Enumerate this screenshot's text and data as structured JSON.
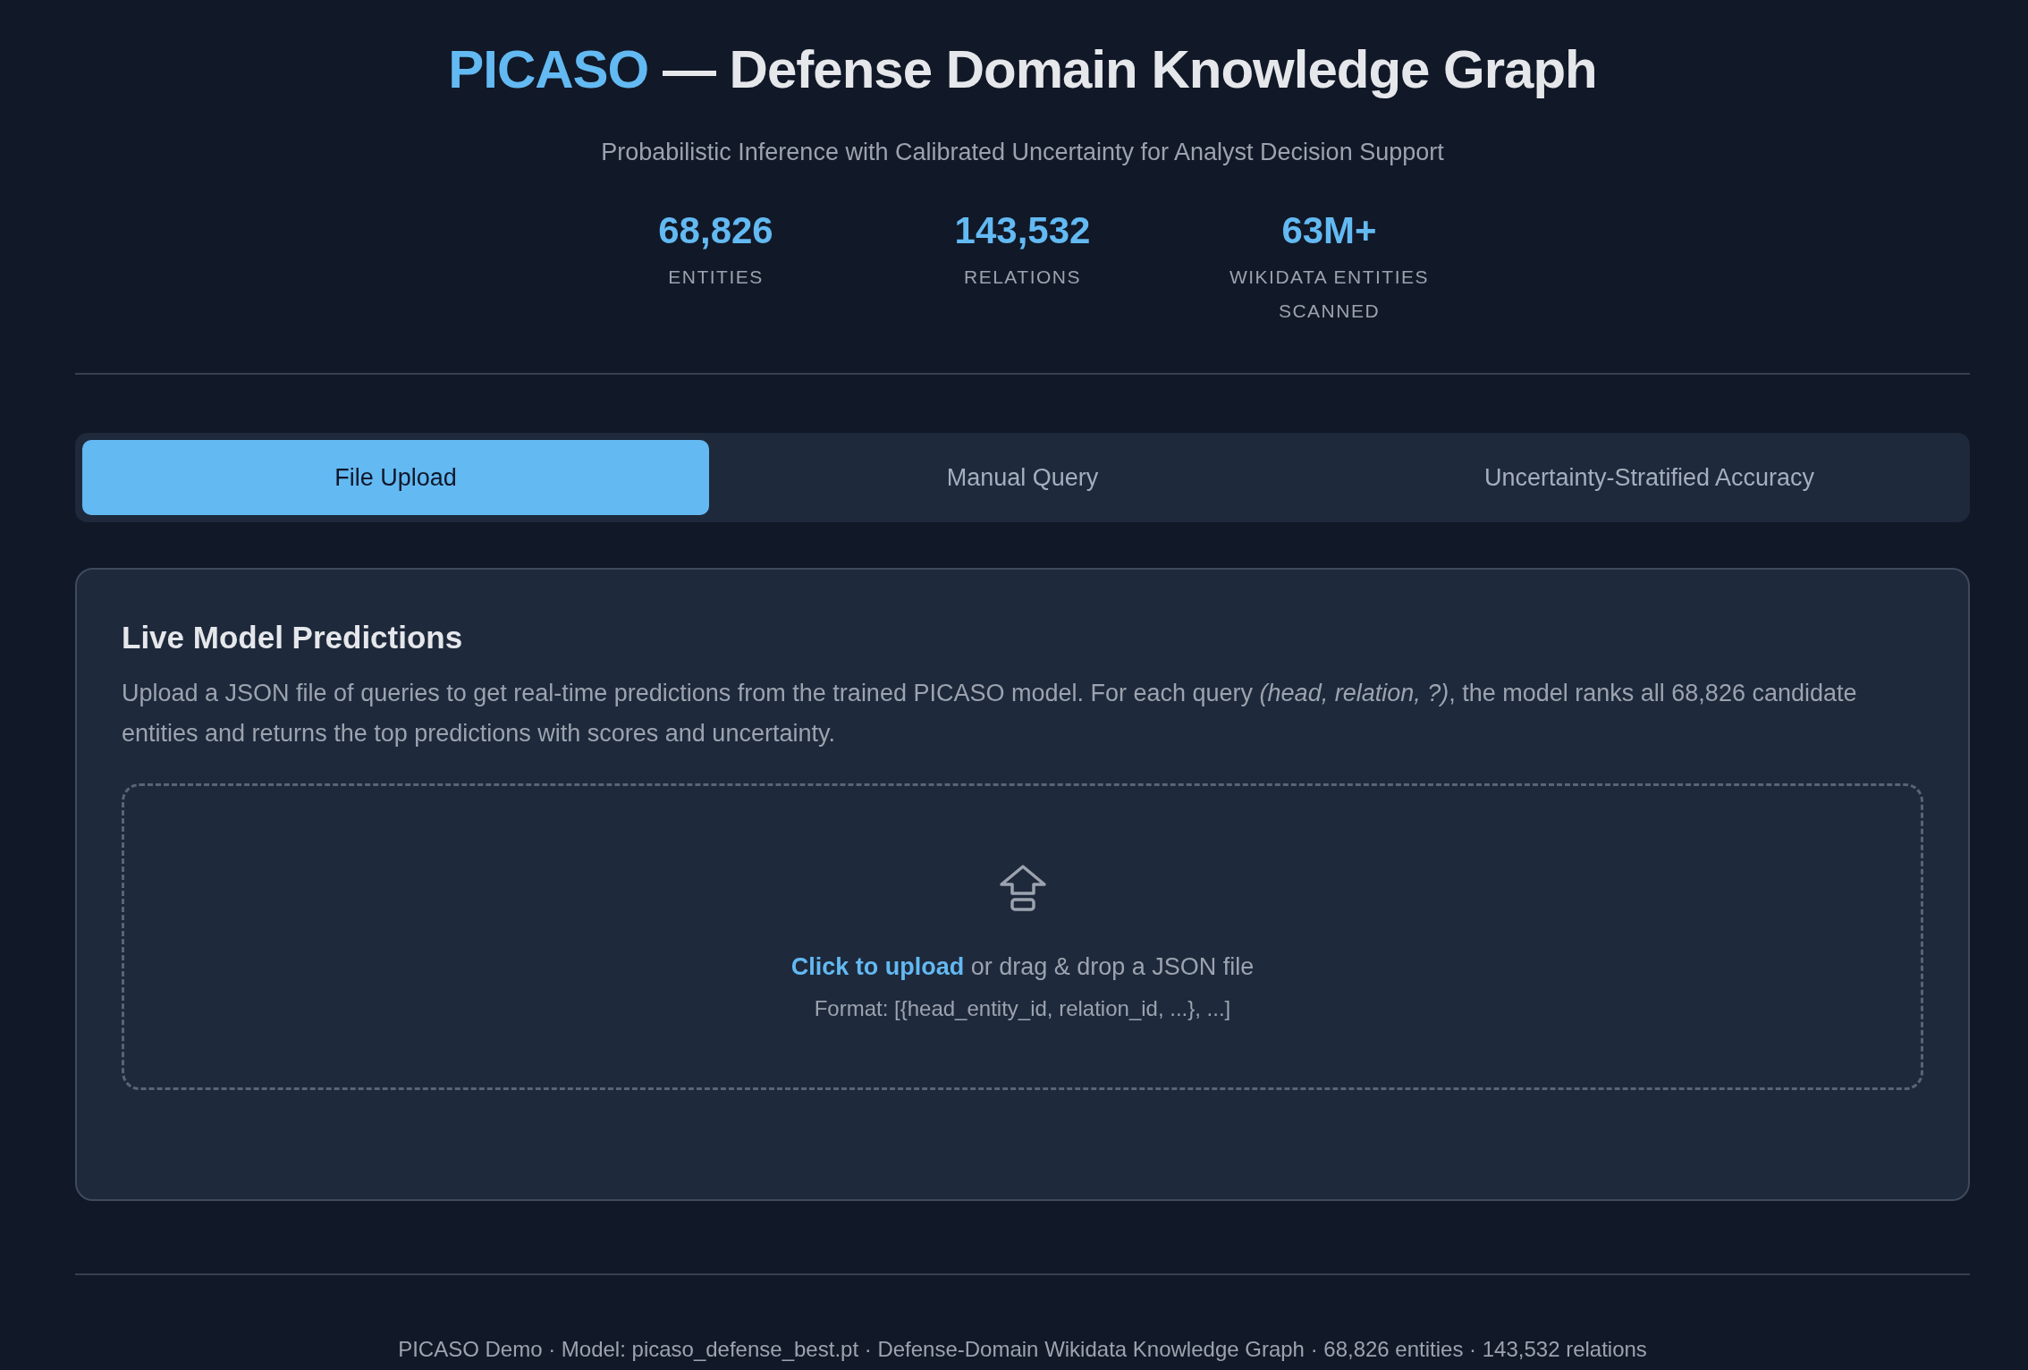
{
  "header": {
    "title_brand": "PICASO",
    "title_rest": "— Defense Domain Knowledge Graph",
    "subtitle": "Probabilistic Inference with Calibrated Uncertainty for Analyst Decision Support"
  },
  "stats": [
    {
      "value": "68,826",
      "label": "ENTITIES"
    },
    {
      "value": "143,532",
      "label": "RELATIONS"
    },
    {
      "value": "63M+",
      "label": "WIKIDATA ENTITIES SCANNED"
    }
  ],
  "tabs": [
    {
      "label": "File Upload",
      "selected": true
    },
    {
      "label": "Manual Query",
      "selected": false
    },
    {
      "label": "Uncertainty-Stratified Accuracy",
      "selected": false
    }
  ],
  "panel": {
    "title": "Live Model Predictions",
    "description": "Upload a JSON file of queries to get real-time predictions from the trained PICASO model. For each query *(head, relation, ?)*, the model ranks all 68,826 candidate entities and returns the top predictions with scores and uncertainty.",
    "dropzone": {
      "link": "Click to upload",
      "text": "or drag & drop a JSON file",
      "format": "Format: [{head_entity_id, relation_id, ...}, ...]"
    }
  },
  "footer": "PICASO Demo · Model: picaso_defense_best.pt · Defense-Domain Wikidata Knowledge Graph · 68,826 entities · 143,532 relations"
}
